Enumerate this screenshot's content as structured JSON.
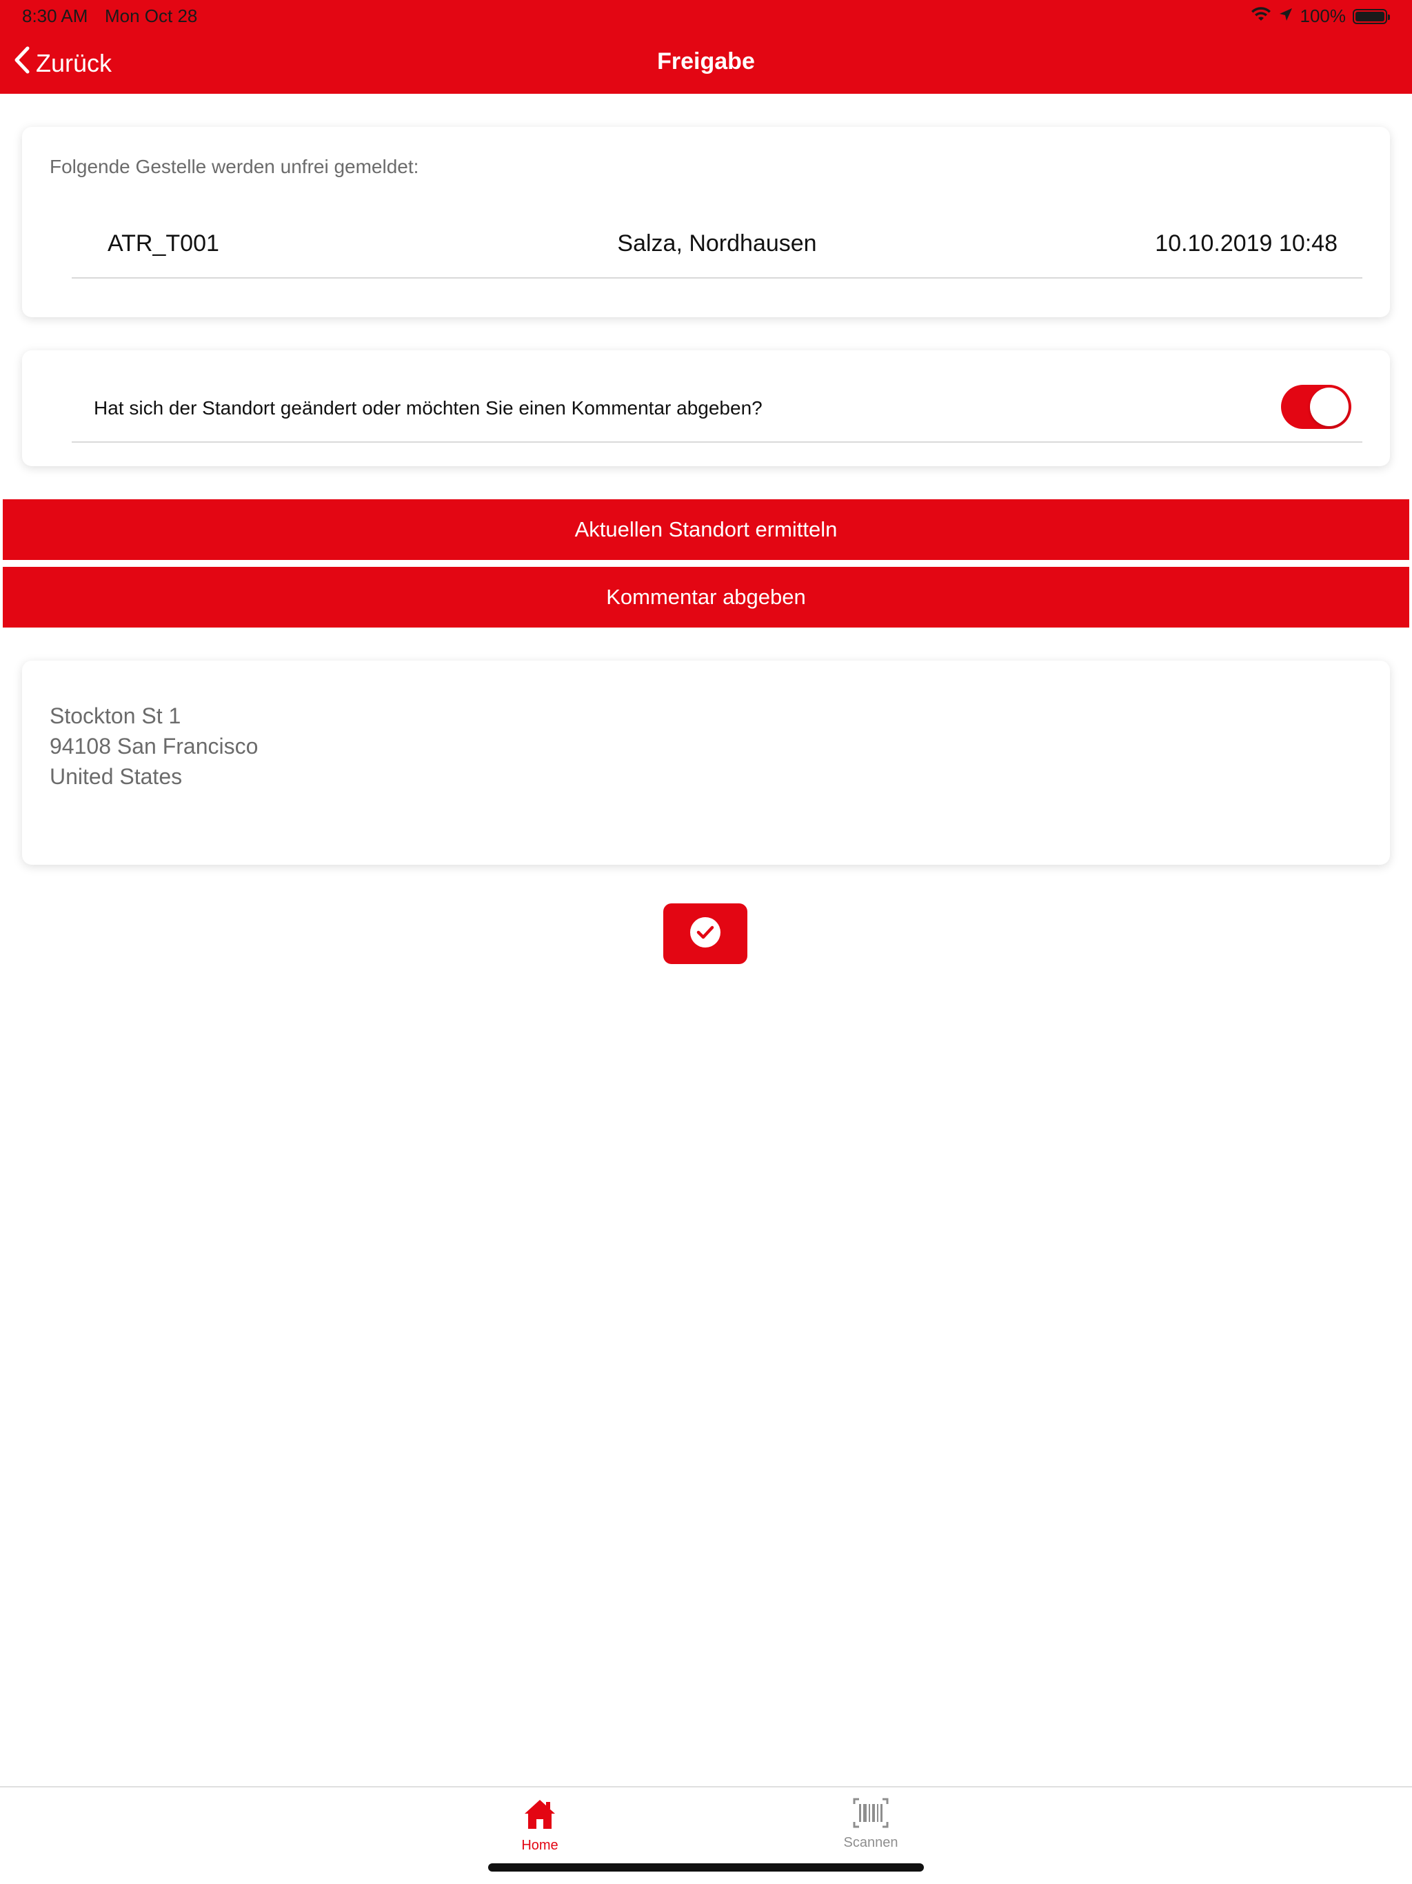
{
  "status_bar": {
    "time": "8:30 AM",
    "date": "Mon Oct 28",
    "battery": "100%"
  },
  "nav": {
    "back_label": "Zurück",
    "title": "Freigabe"
  },
  "release_card": {
    "intro": "Folgende Gestelle werden unfrei gemeldet:",
    "rack": {
      "id": "ATR_T001",
      "location": "Salza, Nordhausen",
      "datetime": "10.10.2019 10:48"
    }
  },
  "comment_toggle": {
    "label": "Hat sich der Standort geändert oder möchten Sie einen Kommentar abgeben?",
    "enabled": true
  },
  "actions": {
    "locate_label": "Aktuellen Standort ermitteln",
    "comment_label": "Kommentar abgeben"
  },
  "address": {
    "line1": "Stockton St 1",
    "line2": "94108 San Francisco",
    "line3": "United States"
  },
  "tabs": [
    {
      "label": "Home",
      "icon": "home-icon",
      "active": true
    },
    {
      "label": "Scannen",
      "icon": "barcode-icon",
      "active": false
    }
  ],
  "colors": {
    "brand_red": "#e30613",
    "inactive_tab": "#8e8e8e"
  }
}
